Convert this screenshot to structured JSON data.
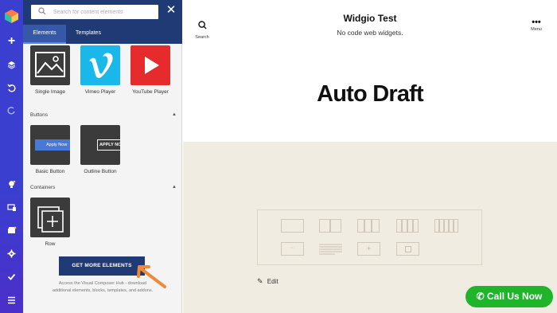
{
  "toolbar": {
    "icons": [
      "logo-icon",
      "add-icon",
      "layers-icon",
      "undo-icon",
      "redo-icon",
      "bulb-icon",
      "devices-icon",
      "hub-icon",
      "settings-icon",
      "check-icon",
      "menu-icon"
    ]
  },
  "panel": {
    "search_placeholder": "Search for content elements",
    "tabs": {
      "elements": "Elements",
      "templates": "Templates"
    },
    "elements_top": [
      {
        "label": "Single Image"
      },
      {
        "label": "Vimeo Player"
      },
      {
        "label": "YouTube Player"
      }
    ],
    "buttons_section": "Buttons",
    "buttons": [
      {
        "label": "Basic Button",
        "preview": "Apply Now"
      },
      {
        "label": "Outline Button",
        "preview": "APPLY NO"
      }
    ],
    "containers_section": "Containers",
    "containers": [
      {
        "label": "Row"
      }
    ],
    "get_more": "GET MORE ELEMENTS",
    "hub_text": "Access the Visual Composer Hub - download additional elements, blocks, templates, and addons."
  },
  "site": {
    "title": "Widgio Test",
    "description": "No code web widgets.",
    "search_label": "Search",
    "menu_label": "Menu",
    "page_title": "Auto Draft",
    "edit_label": "Edit"
  },
  "call_button": "Call Us Now",
  "colors": {
    "toolbar": "#3a3fd0",
    "panel_header": "#1f3a74",
    "tab_active": "#3558a8",
    "content_bg": "#f1ece1",
    "call_green": "#1fb52a",
    "arrow": "#f08a3a"
  }
}
